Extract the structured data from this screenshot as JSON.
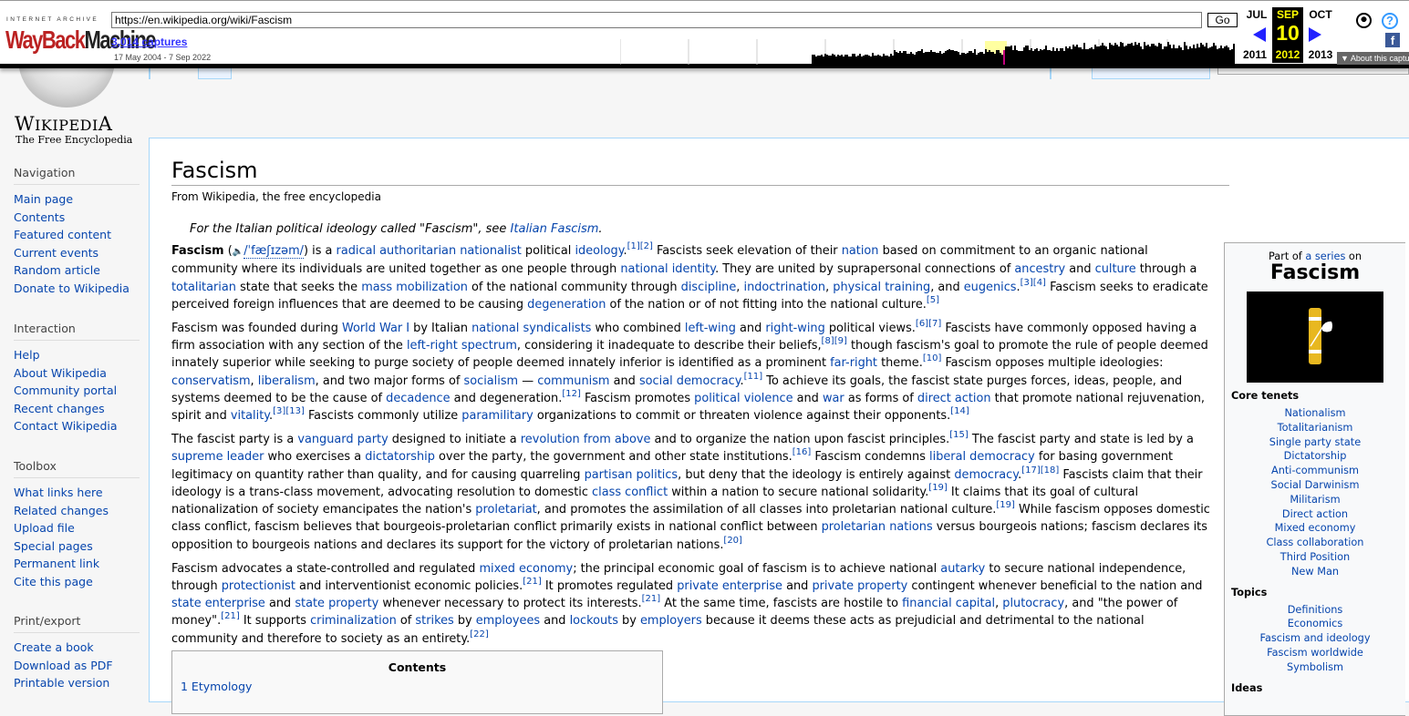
{
  "wayback": {
    "ia_label": "INTERNET ARCHIVE",
    "logo_a": "WayBack",
    "logo_b": "Machine",
    "url": "https://en.wikipedia.org/wiki/Fascism",
    "go": "Go",
    "captures": "3,014 captures",
    "range": "17 May 2004 - 7 Sep 2022",
    "prev_month": "JUL",
    "cur_month": "SEP",
    "next_month": "OCT",
    "day": "10",
    "prev_year": "2011",
    "cur_year": "2012",
    "next_year": "2013",
    "about": "▼ About this capture",
    "accent": "#ffff00"
  },
  "logo": {
    "wordmark_big": "W",
    "wordmark": "IKIPEDI",
    "wordmark_end": "A",
    "tagline": "The Free Encyclopedia"
  },
  "sidebar": [
    {
      "heading": "Navigation",
      "items": [
        "Main page",
        "Contents",
        "Featured content",
        "Current events",
        "Random article",
        "Donate to Wikipedia"
      ]
    },
    {
      "heading": "Interaction",
      "items": [
        "Help",
        "About Wikipedia",
        "Community portal",
        "Recent changes",
        "Contact Wikipedia"
      ]
    },
    {
      "heading": "Toolbox",
      "items": [
        "What links here",
        "Related changes",
        "Upload file",
        "Special pages",
        "Permanent link",
        "Cite this page"
      ]
    },
    {
      "heading": "Print/export",
      "items": [
        "Create a book",
        "Download as PDF",
        "Printable version"
      ]
    }
  ],
  "article": {
    "title": "Fascism",
    "subtitle": "From Wikipedia, the free encyclopedia",
    "hatnote": [
      "For the Italian political ideology called \"Fascism\", see ",
      "Italian Fascism",
      "."
    ],
    "paragraphs": [
      [
        [
          "b",
          "Fascism"
        ],
        [
          "t",
          " ("
        ],
        [
          "s",
          "🔈"
        ],
        [
          "i",
          "/ˈfæʃɪzəm/"
        ],
        [
          "t",
          ") is a "
        ],
        [
          "a",
          "radical authoritarian nationalist"
        ],
        [
          "t",
          " political "
        ],
        [
          "a",
          "ideology"
        ],
        [
          "t",
          "."
        ],
        [
          "r",
          "[1][2]"
        ],
        [
          "t",
          " Fascists seek elevation of their "
        ],
        [
          "a",
          "nation"
        ],
        [
          "t",
          " based on commitment to an organic national community where its individuals are united together as one people through "
        ],
        [
          "a",
          "national identity"
        ],
        [
          "t",
          ". They are united by suprapersonal connections of "
        ],
        [
          "a",
          "ancestry"
        ],
        [
          "t",
          " and "
        ],
        [
          "a",
          "culture"
        ],
        [
          "t",
          " through a "
        ],
        [
          "a",
          "totalitarian"
        ],
        [
          "t",
          " state that seeks the "
        ],
        [
          "a",
          "mass mobilization"
        ],
        [
          "t",
          " of the national community through "
        ],
        [
          "a",
          "discipline"
        ],
        [
          "t",
          ", "
        ],
        [
          "a",
          "indoctrination"
        ],
        [
          "t",
          ", "
        ],
        [
          "a",
          "physical training"
        ],
        [
          "t",
          ", and "
        ],
        [
          "a",
          "eugenics"
        ],
        [
          "t",
          "."
        ],
        [
          "r",
          "[3][4]"
        ],
        [
          "t",
          " Fascism seeks to eradicate perceived foreign influences that are deemed to be causing "
        ],
        [
          "a",
          "degeneration"
        ],
        [
          "t",
          " of the nation or of not fitting into the national culture."
        ],
        [
          "r",
          "[5]"
        ]
      ],
      [
        [
          "t",
          "Fascism was founded during "
        ],
        [
          "a",
          "World War I"
        ],
        [
          "t",
          " by Italian "
        ],
        [
          "a",
          "national syndicalists"
        ],
        [
          "t",
          " who combined "
        ],
        [
          "a",
          "left-wing"
        ],
        [
          "t",
          " and "
        ],
        [
          "a",
          "right-wing"
        ],
        [
          "t",
          " political views."
        ],
        [
          "r",
          "[6][7]"
        ],
        [
          "t",
          " Fascists have commonly opposed having a firm association with any section of the "
        ],
        [
          "a",
          "left-right spectrum"
        ],
        [
          "t",
          ", considering it inadequate to describe their beliefs,"
        ],
        [
          "r",
          "[8][9]"
        ],
        [
          "t",
          " though fascism's goal to promote the rule of people deemed innately superior while seeking to purge society of people deemed innately inferior is identified as a prominent "
        ],
        [
          "a",
          "far-right"
        ],
        [
          "t",
          " theme."
        ],
        [
          "r",
          "[10]"
        ],
        [
          "t",
          " Fascism opposes multiple ideologies: "
        ],
        [
          "a",
          "conservatism"
        ],
        [
          "t",
          ", "
        ],
        [
          "a",
          "liberalism"
        ],
        [
          "t",
          ", and two major forms of "
        ],
        [
          "a",
          "socialism"
        ],
        [
          "t",
          " — "
        ],
        [
          "a",
          "communism"
        ],
        [
          "t",
          " and "
        ],
        [
          "a",
          "social democracy"
        ],
        [
          "t",
          "."
        ],
        [
          "r",
          "[11]"
        ],
        [
          "t",
          " To achieve its goals, the fascist state purges forces, ideas, people, and systems deemed to be the cause of "
        ],
        [
          "a",
          "decadence"
        ],
        [
          "t",
          " and degeneration."
        ],
        [
          "r",
          "[12]"
        ],
        [
          "t",
          " Fascism promotes "
        ],
        [
          "a",
          "political violence"
        ],
        [
          "t",
          " and "
        ],
        [
          "a",
          "war"
        ],
        [
          "t",
          " as forms of "
        ],
        [
          "a",
          "direct action"
        ],
        [
          "t",
          " that promote national rejuvenation, spirit and "
        ],
        [
          "a",
          "vitality"
        ],
        [
          "t",
          "."
        ],
        [
          "r",
          "[3][13]"
        ],
        [
          "t",
          " Fascists commonly utilize "
        ],
        [
          "a",
          "paramilitary"
        ],
        [
          "t",
          " organizations to commit or threaten violence against their opponents."
        ],
        [
          "r",
          "[14]"
        ]
      ],
      [
        [
          "t",
          "The fascist party is a "
        ],
        [
          "a",
          "vanguard party"
        ],
        [
          "t",
          " designed to initiate a "
        ],
        [
          "a",
          "revolution from above"
        ],
        [
          "t",
          " and to organize the nation upon fascist principles."
        ],
        [
          "r",
          "[15]"
        ],
        [
          "t",
          " The fascist party and state is led by a "
        ],
        [
          "a",
          "supreme leader"
        ],
        [
          "t",
          " who exercises a "
        ],
        [
          "a",
          "dictatorship"
        ],
        [
          "t",
          " over the party, the government and other state institutions."
        ],
        [
          "r",
          "[16]"
        ],
        [
          "t",
          " Fascism condemns "
        ],
        [
          "a",
          "liberal democracy"
        ],
        [
          "t",
          " for basing government legitimacy on quantity rather than quality, and for causing quarreling "
        ],
        [
          "a",
          "partisan politics"
        ],
        [
          "t",
          ", but deny that the ideology is entirely against "
        ],
        [
          "a",
          "democracy"
        ],
        [
          "t",
          "."
        ],
        [
          "r",
          "[17][18]"
        ],
        [
          "t",
          " Fascists claim that their ideology is a trans-class movement, advocating resolution to domestic "
        ],
        [
          "a",
          "class conflict"
        ],
        [
          "t",
          " within a nation to secure national solidarity."
        ],
        [
          "r",
          "[19]"
        ],
        [
          "t",
          " It claims that its goal of cultural nationalization of society emancipates the nation's "
        ],
        [
          "a",
          "proletariat"
        ],
        [
          "t",
          ", and promotes the assimilation of all classes into proletarian national culture."
        ],
        [
          "r",
          "[19]"
        ],
        [
          "t",
          " While fascism opposes domestic class conflict, fascism believes that bourgeois-proletarian conflict primarily exists in national conflict between "
        ],
        [
          "a",
          "proletarian nations"
        ],
        [
          "t",
          " versus bourgeois nations; fascism declares its opposition to bourgeois nations and declares its support for the victory of proletarian nations."
        ],
        [
          "r",
          "[20]"
        ]
      ],
      [
        [
          "t",
          "Fascism advocates a state-controlled and regulated "
        ],
        [
          "a",
          "mixed economy"
        ],
        [
          "t",
          "; the principal economic goal of fascism is to achieve national "
        ],
        [
          "a",
          "autarky"
        ],
        [
          "t",
          " to secure national independence, through "
        ],
        [
          "a",
          "protectionist"
        ],
        [
          "t",
          " and interventionist economic policies."
        ],
        [
          "r",
          "[21]"
        ],
        [
          "t",
          " It promotes regulated "
        ],
        [
          "a",
          "private enterprise"
        ],
        [
          "t",
          " and "
        ],
        [
          "a",
          "private property"
        ],
        [
          "t",
          " contingent whenever beneficial to the nation and "
        ],
        [
          "a",
          "state enterprise"
        ],
        [
          "t",
          " and "
        ],
        [
          "a",
          "state property"
        ],
        [
          "t",
          " whenever necessary to protect its interests."
        ],
        [
          "r",
          "[21]"
        ],
        [
          "t",
          " At the same time, fascists are hostile to "
        ],
        [
          "a",
          "financial capital"
        ],
        [
          "t",
          ", "
        ],
        [
          "a",
          "plutocracy"
        ],
        [
          "t",
          ", and \"the power of money\"."
        ],
        [
          "r",
          "[21]"
        ],
        [
          "t",
          " It supports "
        ],
        [
          "a",
          "criminalization"
        ],
        [
          "t",
          " of "
        ],
        [
          "a",
          "strikes"
        ],
        [
          "t",
          " by "
        ],
        [
          "a",
          "employees"
        ],
        [
          "t",
          " and "
        ],
        [
          "a",
          "lockouts"
        ],
        [
          "t",
          " by "
        ],
        [
          "a",
          "employers"
        ],
        [
          "t",
          " because it deems these acts as prejudicial and detrimental to the national community and therefore to society as an entirety."
        ],
        [
          "r",
          "[22]"
        ]
      ]
    ]
  },
  "infobox": {
    "part_a": "Part of ",
    "part_link": "a series",
    "part_b": " on",
    "title": "Fascism",
    "sections": [
      {
        "heading": "Core tenets",
        "items": [
          "Nationalism",
          "Totalitarianism",
          "Single party state",
          "Dictatorship",
          "Anti-communism",
          "Social Darwinism",
          "Militarism",
          "Direct action",
          "Mixed economy",
          "Class collaboration",
          "Third Position",
          "New Man"
        ]
      },
      {
        "heading": "Topics",
        "items": [
          "Definitions",
          "Economics",
          "Fascism and ideology",
          "Fascism worldwide",
          "Symbolism"
        ]
      },
      {
        "heading": "Ideas",
        "items": []
      }
    ]
  },
  "toc": {
    "title": "Contents",
    "items": [
      "1 Etymology"
    ]
  }
}
